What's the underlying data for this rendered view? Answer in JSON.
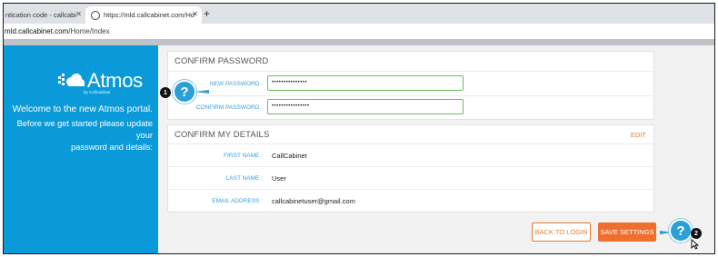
{
  "browser": {
    "tabs": [
      {
        "label": "ntication code - callcabi"
      },
      {
        "label": "https://mld.callcabinet.com/Ho"
      }
    ],
    "new_tab": "+",
    "url_domain": "mld.callcabinet.com",
    "url_path": "/Home/Index"
  },
  "left_panel": {
    "logo_text": "Atmos",
    "logo_sub": "by CallCabinet",
    "welcome_line1": "Welcome to the new Atmos portal.",
    "welcome_line2": "Before we get started please update your",
    "welcome_line3": "password and details:",
    "colors": {
      "background": "#0b9ad9"
    }
  },
  "confirm_password": {
    "title": "CONFIRM PASSWORD",
    "new_password_label": "NEW PASSWORD :",
    "new_password_value": "•••••••••••••••",
    "confirm_password_label": "CONFIRM PASSWORD :",
    "confirm_password_value": "••••••••••••••••"
  },
  "confirm_details": {
    "title": "CONFIRM MY DETAILS",
    "edit_label": "EDIT",
    "fields": [
      {
        "label": "FIRST NAME :",
        "value": "CallCabinet"
      },
      {
        "label": "LAST NAME :",
        "value": "User"
      },
      {
        "label": "EMAIL ADDRESS :",
        "value": "callcabinetuser@gmail.com"
      }
    ]
  },
  "actions": {
    "back_label": "BACK TO LOGIN",
    "save_label": "SAVE SETTINGS"
  },
  "callouts": [
    {
      "number": "1",
      "symbol": "?"
    },
    {
      "number": "2",
      "symbol": "?"
    }
  ],
  "colors": {
    "accent_orange": "#ef6f2e",
    "label_blue": "#3ba0d6",
    "valid_green": "#6dbd5f"
  }
}
